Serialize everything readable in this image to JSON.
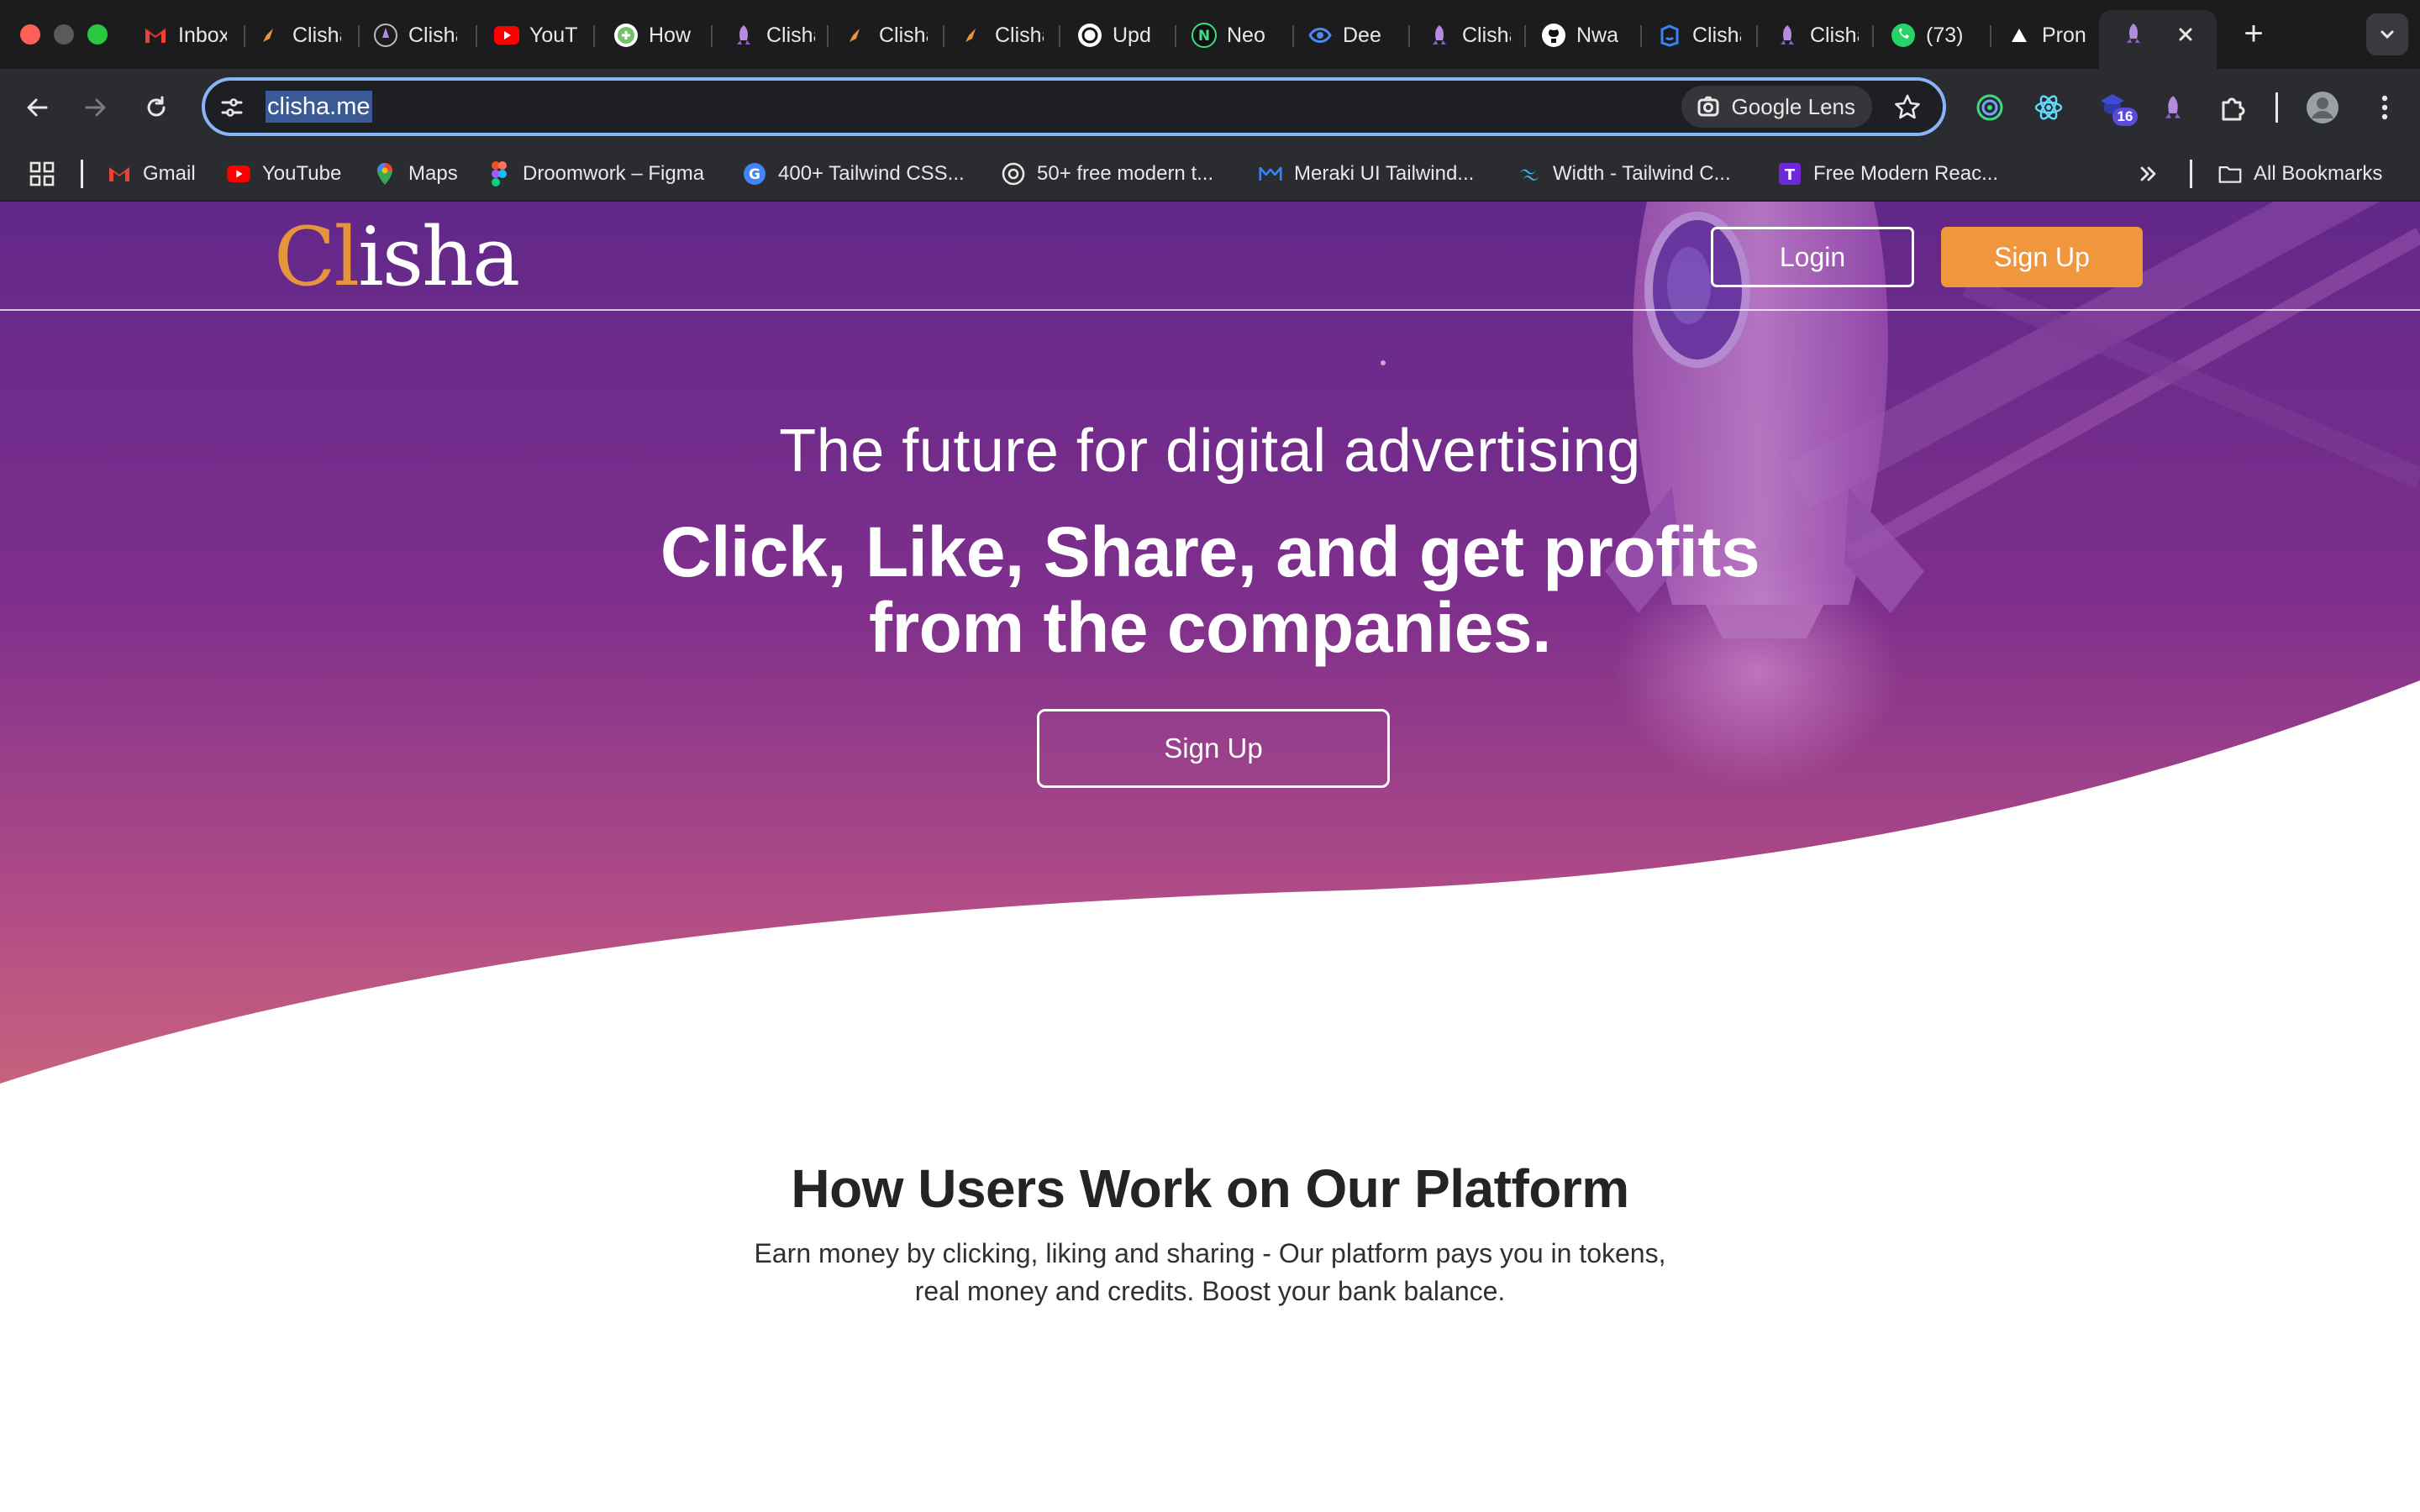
{
  "browser": {
    "tabs": [
      {
        "title": "Inbox",
        "icon": "gmail-icon"
      },
      {
        "title": "Clisha",
        "icon": "rocket-icon"
      },
      {
        "title": "Clisha",
        "icon": "clisha-icon"
      },
      {
        "title": "YouTube",
        "icon": "youtube-icon"
      },
      {
        "title": "How",
        "icon": "how-icon"
      },
      {
        "title": "Clisha",
        "icon": "rocket-icon"
      },
      {
        "title": "Clisha",
        "icon": "rocket-icon"
      },
      {
        "title": "Clisha",
        "icon": "rocket-icon"
      },
      {
        "title": "Upd",
        "icon": "openai-icon"
      },
      {
        "title": "Neo",
        "icon": "neo-icon"
      },
      {
        "title": "Dee",
        "icon": "deepl-icon"
      },
      {
        "title": "Clisha",
        "icon": "rocket-icon"
      },
      {
        "title": "Nwa",
        "icon": "github-icon"
      },
      {
        "title": "Clisha",
        "icon": "azure-icon"
      },
      {
        "title": "Clisha",
        "icon": "rocket-icon"
      },
      {
        "title": "(73)",
        "icon": "whatsapp-icon"
      },
      {
        "title": "Pron",
        "icon": "triangle-icon"
      }
    ],
    "active_tab_icon": "rocket-icon",
    "address_bar": {
      "url": "clisha.me",
      "lens_label": "Google Lens"
    },
    "extension_badge": "16",
    "bookmarks": [
      {
        "label": "Gmail",
        "icon": "gmail-icon"
      },
      {
        "label": "YouTube",
        "icon": "youtube-icon"
      },
      {
        "label": "Maps",
        "icon": "maps-icon"
      },
      {
        "label": "Droomwork – Figma",
        "icon": "figma-icon"
      },
      {
        "label": "400+ Tailwind CSS...",
        "icon": "google-icon"
      },
      {
        "label": "50+ free modern t...",
        "icon": "circle-icon"
      },
      {
        "label": "Meraki UI Tailwind...",
        "icon": "meraki-icon"
      },
      {
        "label": "Width - Tailwind C...",
        "icon": "tailwind-icon"
      },
      {
        "label": "Free Modern Reac...",
        "icon": "t-icon"
      }
    ],
    "all_bookmarks_label": "All Bookmarks"
  },
  "site": {
    "logo_part1": "Cl",
    "logo_part2": "isha",
    "login_label": "Login",
    "signup_label": "Sign Up",
    "hero": {
      "subtitle": "The future for digital advertising",
      "title_line1": "Click, Like, Share, and get profits",
      "title_line2": "from the companies.",
      "cta_label": "Sign Up"
    },
    "section": {
      "title": "How Users Work on Our Platform",
      "description": "Earn money by clicking, liking and sharing - Our platform pays you in tokens, real money and credits. Boost your bank balance."
    }
  },
  "colors": {
    "hero_top": "#6a2a8a",
    "hero_bottom": "#c0567f",
    "accent_orange": "#f0963c",
    "omnibox_focus": "#8ab4f8"
  }
}
